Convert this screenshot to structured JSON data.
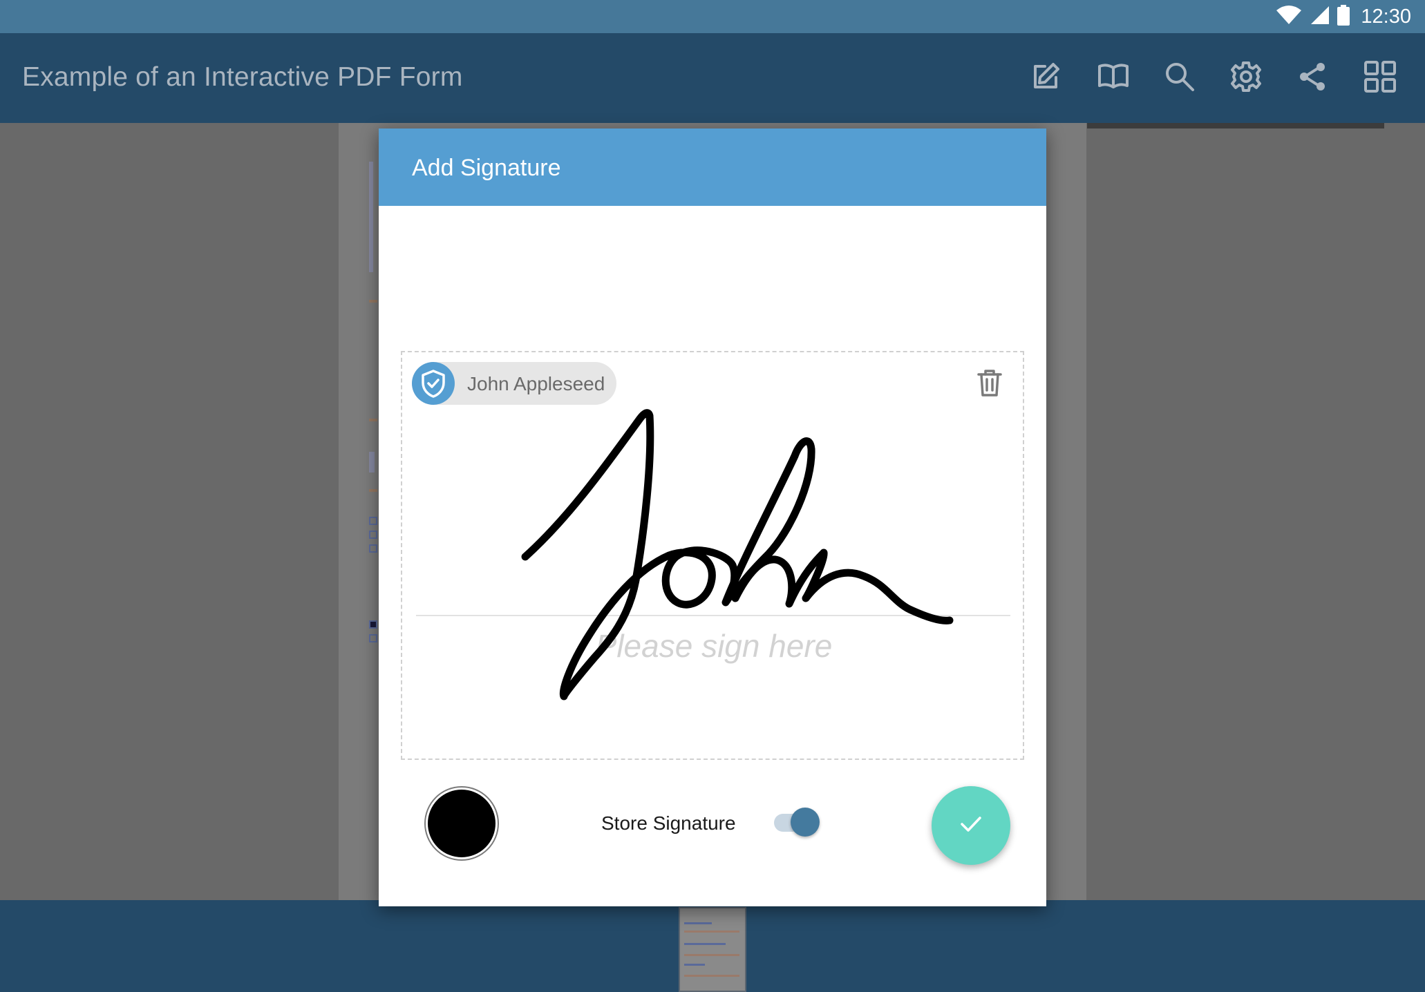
{
  "status_bar": {
    "time": "12:30",
    "icons": [
      "wifi-icon",
      "cellular-signal-icon",
      "battery-icon"
    ]
  },
  "toolbar": {
    "title": "Example of an Interactive PDF Form",
    "actions": [
      "edit-annotations-icon",
      "reader-view-icon",
      "search-icon",
      "settings-icon",
      "share-icon",
      "thumbnail-grid-icon"
    ]
  },
  "dialog": {
    "title": "Add Signature",
    "signer_name": "John Appleseed",
    "placeholder": "Please sign here",
    "store_signature_label": "Store Signature",
    "store_signature_enabled": true,
    "ink_color": "#000000",
    "accent_color": "#559ed2",
    "confirm_color": "#62d6c3"
  }
}
